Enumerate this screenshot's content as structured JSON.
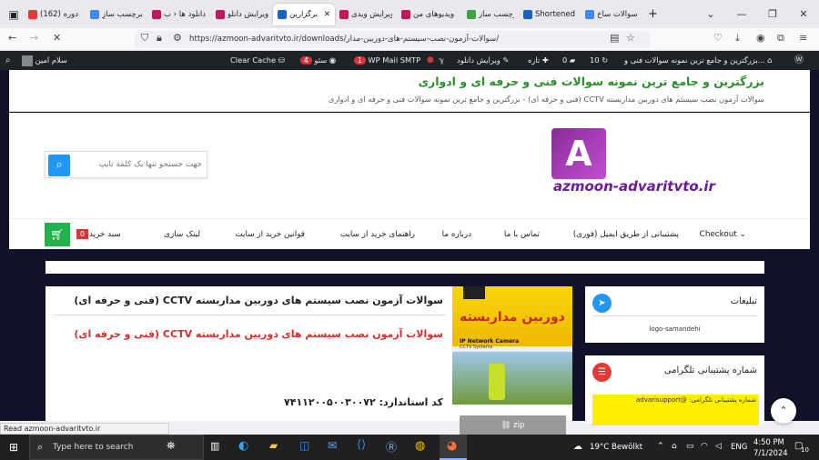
{
  "browser": {
    "tabs": [
      {
        "label": "(162) دوره",
        "fav": "#e53935"
      },
      {
        "label": "برچسب سازِ",
        "fav": "#4285f4"
      },
      {
        "label": "دانلود ها ‹ ب",
        "fav": "#c2185b"
      },
      {
        "label": "ویرایش دانلو",
        "fav": "#c2185b"
      },
      {
        "label": "برگزارین",
        "fav": "#1565c0"
      },
      {
        "label": "ویرایش ویدی",
        "fav": "#c2185b"
      },
      {
        "label": "ویدیوهای من",
        "fav": "#c2185b"
      },
      {
        "label": "برچسب ساز",
        "fav": "#43a047"
      },
      {
        "label": "Shortened U",
        "fav": "#1565c0"
      },
      {
        "label": "سوالات ساخ",
        "fav": "#4285f4"
      }
    ],
    "url": "https://azmoon-advaritvto.ir/downloads/سوالات-آزمون-نصب-سیستم-های-دوربین-مدار/"
  },
  "wpbar": {
    "greeting": "سلام امین",
    "clear_cache": "Clear Cache",
    "seo_label": "سئو",
    "seo_count": "4",
    "smtp_label": "WP Mail SMTP",
    "smtp_count": "1",
    "edit_download": "ویرایش دانلود",
    "new_label": "تازه",
    "comments_count": "0",
    "updates_count": "10",
    "site_name": "بزرگترین و جامع ترین نمونه سوالات فنی و..."
  },
  "site": {
    "title": "بزرگترین و جامع ترین نمونه سوالات فنی و حرفه ای و ادواری",
    "breadcrumb": "سوالات آزمون نصب سیستم های دوربین مداربسته CCTV (فنی و حرفه ای) - بزرگترین و جامع ترین نمونه سوالات فنی و حرفه ای و ادواری",
    "logo_text": "azmoon-advaritvto.ir",
    "search_placeholder": "جهت جستجو تنها یک کلمه تایپ",
    "menu": [
      "Checkout",
      "پشتیبانی از طریق ایمیل (فوری)",
      "تماس با ما",
      "درباره ما",
      "راهنمای خرید از سایت",
      "قوانین خرید از سایت",
      "لینک سازی"
    ],
    "cart_label": "سبد خرید",
    "cart_count": "0"
  },
  "product": {
    "title": "سوالات آزمون نصب سیستم های دوربین مداربسته CCTV (فنی و حرفه ای)",
    "red_title": "سوالات آزمون نصب سیستم های دوربین مداربسته CCTV (فنی و حرفه ای)",
    "standard_code": "کد استاندارد: ۷۴۱۱۲۰۰۵۰۰۳۰۰۷۲",
    "image_title": "دوربین مداربسته",
    "image_subtitle": "IP Network Camera",
    "image_caption": "CCTV Systems",
    "zip_label": "zip"
  },
  "sidebar": {
    "ads_title": "تبلیغات",
    "ads_image": "logo-samandehi",
    "telegram_title": "شماره پشتیبانی تلگرامی",
    "telegram_text": "شماره پشتیبانی تلگرامی: @advarisupport"
  },
  "status_text": "Read azmoon-advaritvto.ir",
  "taskbar": {
    "search_placeholder": "Type here to search",
    "weather": "19°C  Bewölkt",
    "lang": "ENG",
    "time": "4:50 PM",
    "date": "7/1/2024",
    "notif_count": "10"
  }
}
